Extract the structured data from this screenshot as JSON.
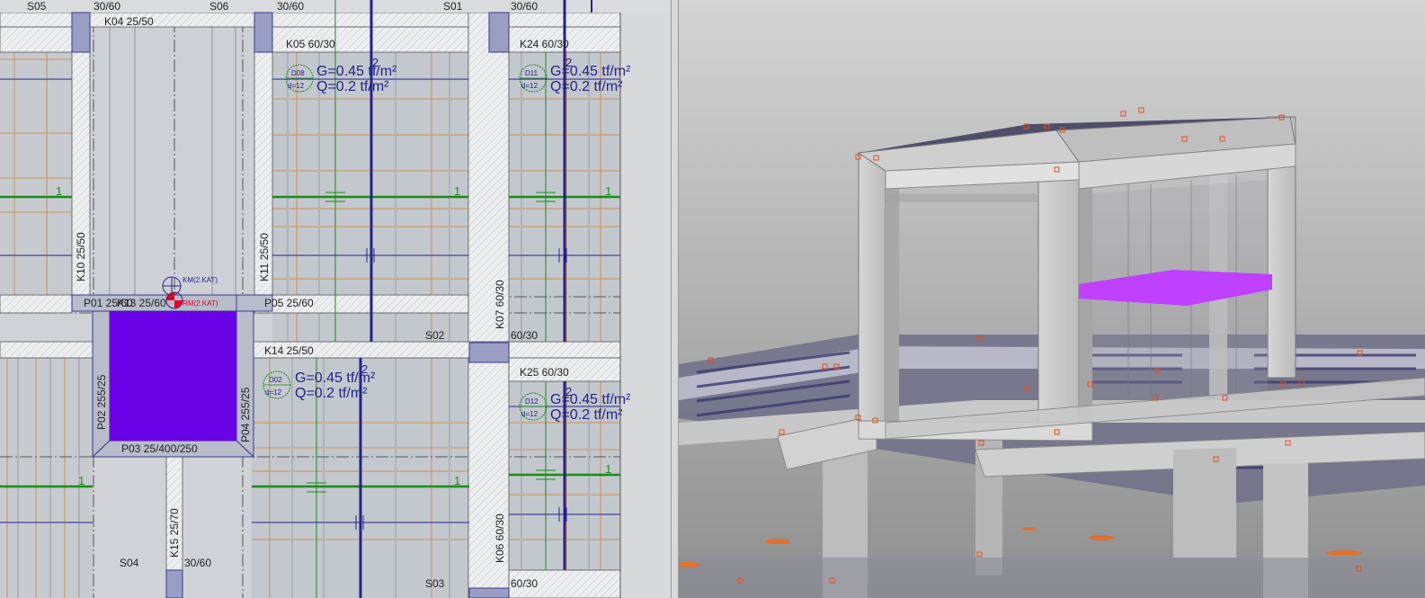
{
  "plan_view": {
    "slabs": [
      "S05",
      "S06",
      "S01",
      "S02",
      "S03",
      "S04"
    ],
    "beams": {
      "k04": "K04 25/50",
      "k05": "K05 60/30",
      "k24": "K24 60/30",
      "k10": "K10 25/50",
      "k11": "K11 25/50",
      "k07": "K07 60/30",
      "k14": "K14 25/50",
      "k25": "K25 60/30",
      "k15": "K15 25/70",
      "k06": "K06 60/30",
      "k13": "K13 25/60"
    },
    "shear_walls": {
      "p01": "P01 25/60",
      "p05": "P05 25/60",
      "p02": "P02 255/25",
      "p04": "P04 255/25",
      "p03": "P03 25/400/250"
    },
    "columns": [
      "30/60",
      "30/60",
      "30/60",
      "30/60",
      "60/30",
      "30/60",
      "60/30"
    ],
    "slab_loads": [
      {
        "id": "D08",
        "thickness": "d=12",
        "g": "G=0.45 tf/m²",
        "q": "Q=0.2 tf/m²"
      },
      {
        "id": "D11",
        "thickness": "d=12",
        "g": "G=0.45 tf/m²",
        "q": "Q=0.2 tf/m²"
      },
      {
        "id": "D02",
        "thickness": "d=12",
        "g": "G=0.45 tf/m²",
        "q": "Q=0.2 tf/m²"
      },
      {
        "id": "D12",
        "thickness": "d=12",
        "g": "G=0.45 tf/m²",
        "q": "Q=0.2 tf/m²"
      }
    ],
    "span_marks": [
      "1",
      "1",
      "1",
      "1",
      "1",
      "1"
    ],
    "direction_marks": [
      "2",
      "2",
      "2",
      "2"
    ],
    "km_markers": [
      "KM(2.KAT)",
      "RM(2.KAT)"
    ],
    "colors": {
      "background": "#cfd3d8",
      "beam_outline": "#3a3a8a",
      "load_text": "#23238a",
      "support_line": "#1a8a1a",
      "elevator_core": "#6a00e6",
      "rib_line": "#d08030",
      "highlight_3d": "#bf40ff"
    }
  },
  "model_view": {
    "background_top": "#d4d4d4",
    "background_bottom": "#8f8f8f"
  }
}
